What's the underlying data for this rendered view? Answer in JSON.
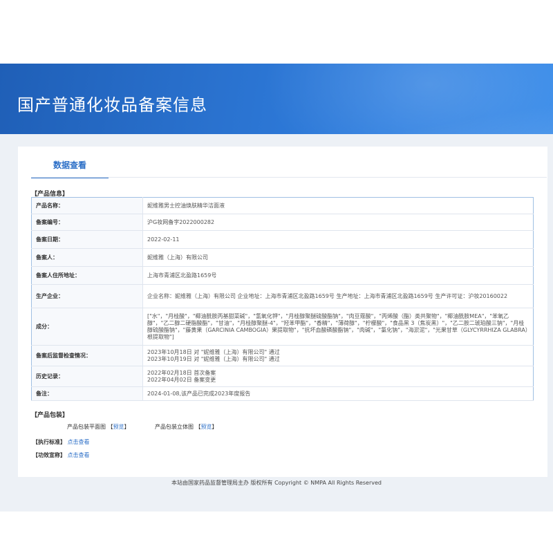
{
  "header": {
    "title": "国产普通化妆品备案信息"
  },
  "tabs": {
    "active": "数据查看"
  },
  "product_info": {
    "section_title": "【产品信息】",
    "rows": [
      {
        "label": "产品名称：",
        "value": "妮维雅男士控油焕肤精华洁面液"
      },
      {
        "label": "备案编号：",
        "value": "沪G妆网备字2022000282"
      },
      {
        "label": "备案日期：",
        "value": "2022-02-11"
      },
      {
        "label": "备案人：",
        "value": "妮维雅（上海）有限公司"
      },
      {
        "label": "备案人住所地址：",
        "value": "上海市青浦区北盈路1659号"
      },
      {
        "label": "生产企业：",
        "value": "企业名称：妮维雅（上海）有限公司 企业地址：上海市青浦区北盈路1659号 生产地址：上海市青浦区北盈路1659号 生产许可证：沪妆20160022"
      },
      {
        "label": "成分：",
        "value": "[\"水\"，\"月桂酸\"，\"椰油酰胺丙基甜菜碱\"，\"氢氧化钾\"，\"月桂醇聚醚硫酸酯钠\"，\"肉豆蔻酸\"，\"丙烯酸（酯）类共聚物\"，\"椰油酰胺MEA\"，\"苯氧乙醇\"，\"乙二醇二硬脂酸酯\"，\"甘油\"，\"月桂醇聚醚-4\"，\"羟苯甲酯\"，\"香精\"，\"薄荷醇\"，\"柠檬酸\"，\"食品黑 3（焦炭黑）\"，\"乙二胺二琥珀酸三钠\"，\"月桂醇硫酸酯钠\"，\"藤黄果（GARCINIA CAMBOGIA）果提取物\"，\"抗坏血酸磷酸酯钠\"，\"肉碱\"，\"氯化钠\"，\"海淤泥\"，\"光果甘草（GLYCYRRHIZA GLABRA）根提取物\"]"
      },
      {
        "label": "备案后监督检查情况：",
        "value": "2023年10月18日 对 \"妮维雅（上海）有限公司\" 通过\n2023年10月19日 对 \"妮维雅（上海）有限公司\" 通过"
      },
      {
        "label": "历史记录：",
        "value": "2022年02月18日 首次备案\n2022年04月02日 备案变更"
      },
      {
        "label": "备注：",
        "value": "2024-01-08,该产品已完成2023年度报告"
      }
    ]
  },
  "packaging": {
    "section_title": "【产品包装】",
    "flat_label": "产品包装平面图",
    "flat_link": "预览",
    "solid_label": "产品包装立体图",
    "solid_link": "预览"
  },
  "standard": {
    "label": "【执行标准】",
    "link": "点击查看"
  },
  "efficacy": {
    "label": "【功效宣称】",
    "link": "点击查看"
  },
  "footer": {
    "text": "本站由国家药品监督管理局主办 版权所有 Copyright © NMPA All Rights Reserved"
  }
}
